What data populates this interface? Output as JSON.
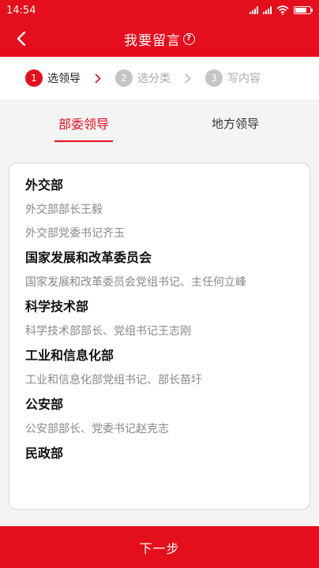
{
  "status_bar": {
    "time": "14:54"
  },
  "header": {
    "title": "我要留言"
  },
  "steps": [
    {
      "num": "1",
      "label": "选领导",
      "active": true
    },
    {
      "num": "2",
      "label": "选分类",
      "active": false
    },
    {
      "num": "3",
      "label": "写内容",
      "active": false
    }
  ],
  "tabs": [
    {
      "label": "部委领导",
      "active": true
    },
    {
      "label": "地方领导",
      "active": false
    }
  ],
  "list": [
    {
      "dept": "外交部",
      "leaders": [
        "外交部部长王毅",
        "外交部党委书记齐玉"
      ]
    },
    {
      "dept": "国家发展和改革委员会",
      "leaders": [
        "国家发展和改革委员会党组书记、主任何立峰"
      ]
    },
    {
      "dept": "科学技术部",
      "leaders": [
        "科学技术部部长、党组书记王志刚"
      ]
    },
    {
      "dept": "工业和信息化部",
      "leaders": [
        "工业和信息化部党组书记、部长苗圩"
      ]
    },
    {
      "dept": "公安部",
      "leaders": [
        "公安部部长、党委书记赵克志"
      ]
    },
    {
      "dept": "民政部",
      "leaders": []
    }
  ],
  "footer": {
    "next_label": "下一步"
  },
  "colors": {
    "accent": "#e50e1c",
    "inactive_step": "#c4c4c4"
  }
}
